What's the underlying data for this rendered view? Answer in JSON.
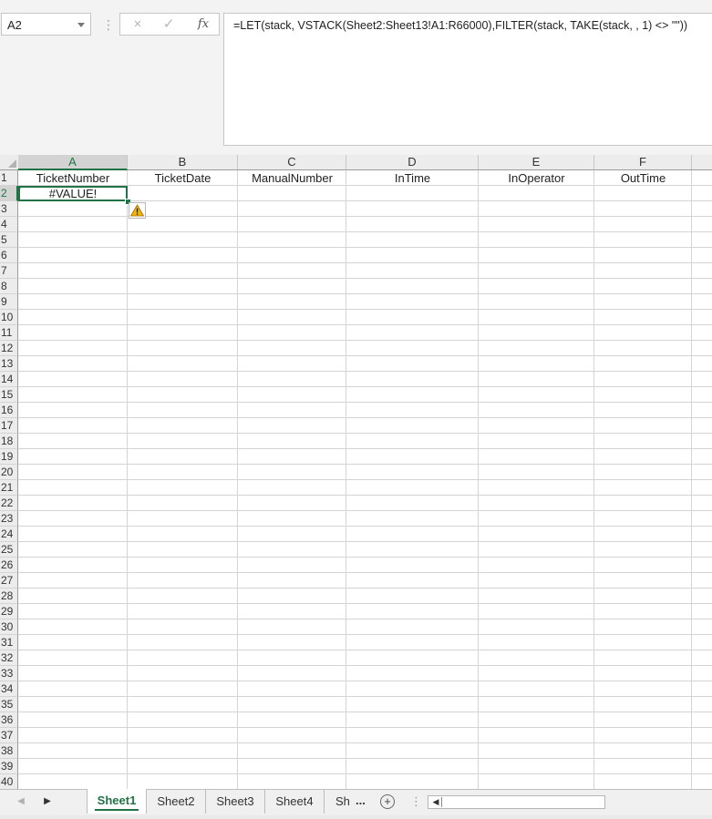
{
  "formula_bar": {
    "name_box": "A2",
    "cancel_icon": "×",
    "enter_icon": "✓",
    "function_label": "fx",
    "formula": "=LET(stack, VSTACK(Sheet2:Sheet13!A1:R66000),FILTER(stack, TAKE(stack, , 1) <> \"\"))"
  },
  "grid": {
    "columns": [
      "A",
      "B",
      "C",
      "D",
      "E",
      "F"
    ],
    "selected_column": "A",
    "rows": [
      "1",
      "2",
      "3",
      "4",
      "5",
      "6",
      "7",
      "8",
      "9",
      "10",
      "11",
      "12",
      "13",
      "14",
      "15",
      "16",
      "17",
      "18",
      "19",
      "20",
      "21",
      "22",
      "23",
      "24",
      "25",
      "26",
      "27",
      "28",
      "29",
      "30",
      "31",
      "32",
      "33",
      "34",
      "35",
      "36",
      "37",
      "38",
      "39",
      "40"
    ],
    "selected_row": "2",
    "header_row": [
      "TicketNumber",
      "TicketDate",
      "ManualNumber",
      "InTime",
      "InOperator",
      "OutTime"
    ],
    "active_cell": "A2",
    "active_cell_value": "#VALUE!"
  },
  "sheet_tabs": {
    "tabs": [
      "Sheet1",
      "Sheet2",
      "Sheet3",
      "Sheet4",
      "Sh"
    ],
    "active_tab": "Sheet1",
    "overflow": "...",
    "add_sheet": "+"
  },
  "colors": {
    "accent": "#217346",
    "warning": "#f4b400",
    "header_background": "#ececec",
    "selected_header_background": "#d3d3d3"
  },
  "icons": [
    "chevron-down-icon",
    "cancel-icon",
    "enter-icon",
    "function-icon",
    "warning-icon",
    "add-sheet-icon",
    "scroll-left-icon"
  ]
}
